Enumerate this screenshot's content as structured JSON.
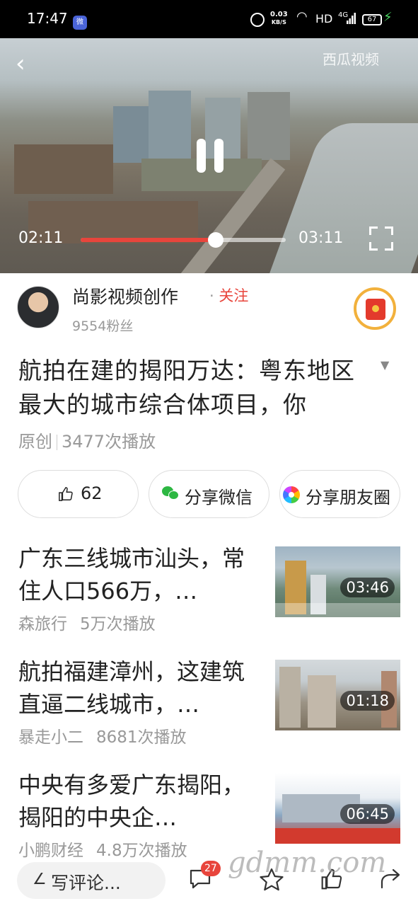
{
  "status_bar": {
    "time": "17:47",
    "app_badge": "微",
    "speed_value": "0.03",
    "speed_unit": "KB/S",
    "hd": "HD",
    "network": "4G",
    "battery": "67"
  },
  "video": {
    "logo": "西瓜视频",
    "current_time": "02:11",
    "total_time": "03:11",
    "progress": 0.66
  },
  "author": {
    "name": "尚影视频创作",
    "follow_dot": "·",
    "follow_label": "关注",
    "fans": "9554粉丝"
  },
  "article": {
    "title": "航拍在建的揭阳万达：粤东地区最大的城市综合体项目，你",
    "tag": "原创",
    "plays": "3477次播放"
  },
  "actions": {
    "like_count": "62",
    "share_wechat": "分享微信",
    "share_moments": "分享朋友圈"
  },
  "related": [
    {
      "title": "广东三线城市汕头，常住人口566万，…",
      "author": "森旅行",
      "plays": "5万次播放",
      "duration": "03:46"
    },
    {
      "title": "航拍福建漳州，这建筑直逼二线城市，…",
      "author": "暴走小二",
      "plays": "8681次播放",
      "duration": "01:18"
    },
    {
      "title": "中央有多爱广东揭阳，揭阳的中央企…",
      "author": "小鹏财经",
      "plays": "4.8万次播放",
      "duration": "06:45"
    }
  ],
  "bottom": {
    "comment_placeholder": "写评论...",
    "comment_count": "27"
  },
  "watermark": "gdmm.com",
  "colors": {
    "accent": "#e8453c",
    "wechat": "#2db742",
    "status_bar": "#000000"
  }
}
